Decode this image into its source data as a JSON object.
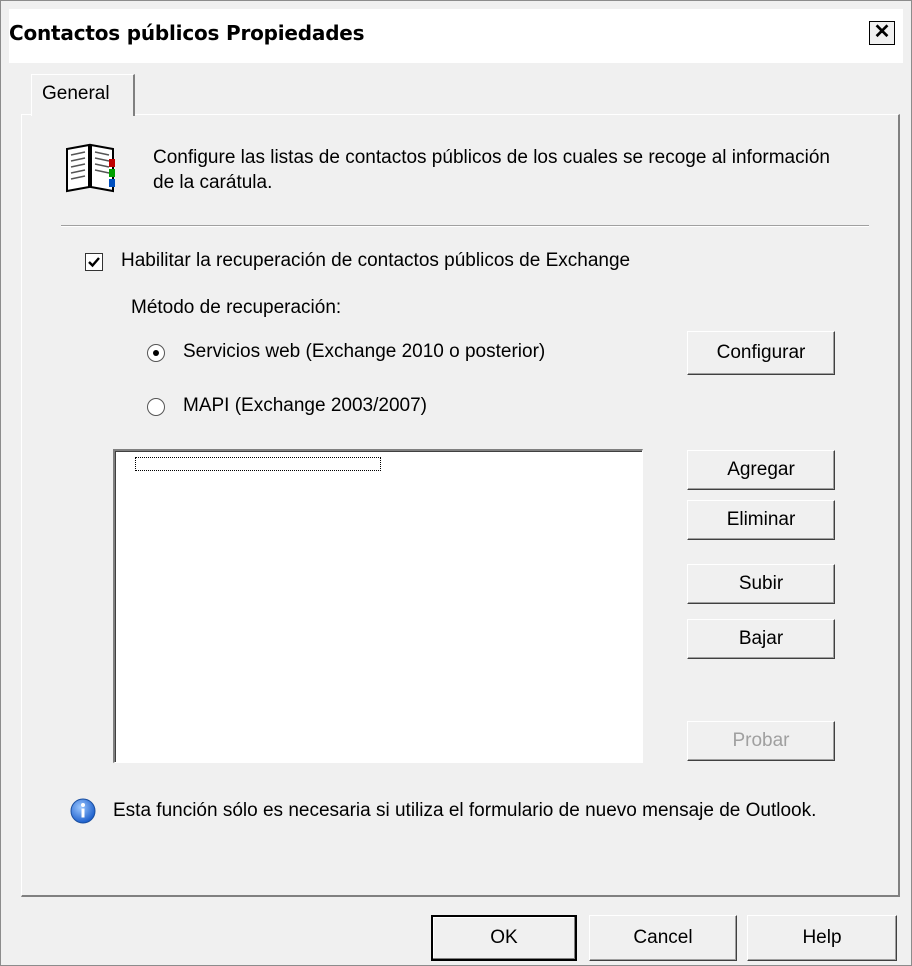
{
  "window": {
    "title": "Contactos públicos Propiedades",
    "close_label": "✕"
  },
  "tabs": [
    {
      "label": "General",
      "selected": true
    }
  ],
  "intro": {
    "icon": "book-icon",
    "text": "Configure las listas de contactos públicos de los cuales se recoge al información de la carátula."
  },
  "enable": {
    "label": "Habilitar la recuperación de contactos públicos de Exchange",
    "checked": true
  },
  "method": {
    "label": "Método de recuperación:",
    "options": [
      {
        "label": "Servicios web (Exchange 2010 o posterior)",
        "selected": true
      },
      {
        "label": "MAPI (Exchange 2003/2007)",
        "selected": false
      }
    ]
  },
  "buttons": {
    "configurar": "Configurar",
    "agregar": "Agregar",
    "eliminar": "Eliminar",
    "subir": "Subir",
    "bajar": "Bajar",
    "probar": "Probar"
  },
  "list": {
    "items": []
  },
  "info": {
    "icon": "info-icon",
    "text": "Esta función sólo es necesaria si utiliza el formulario de nuevo mensaje de Outlook."
  },
  "footer": {
    "ok": "OK",
    "cancel": "Cancel",
    "help": "Help"
  }
}
